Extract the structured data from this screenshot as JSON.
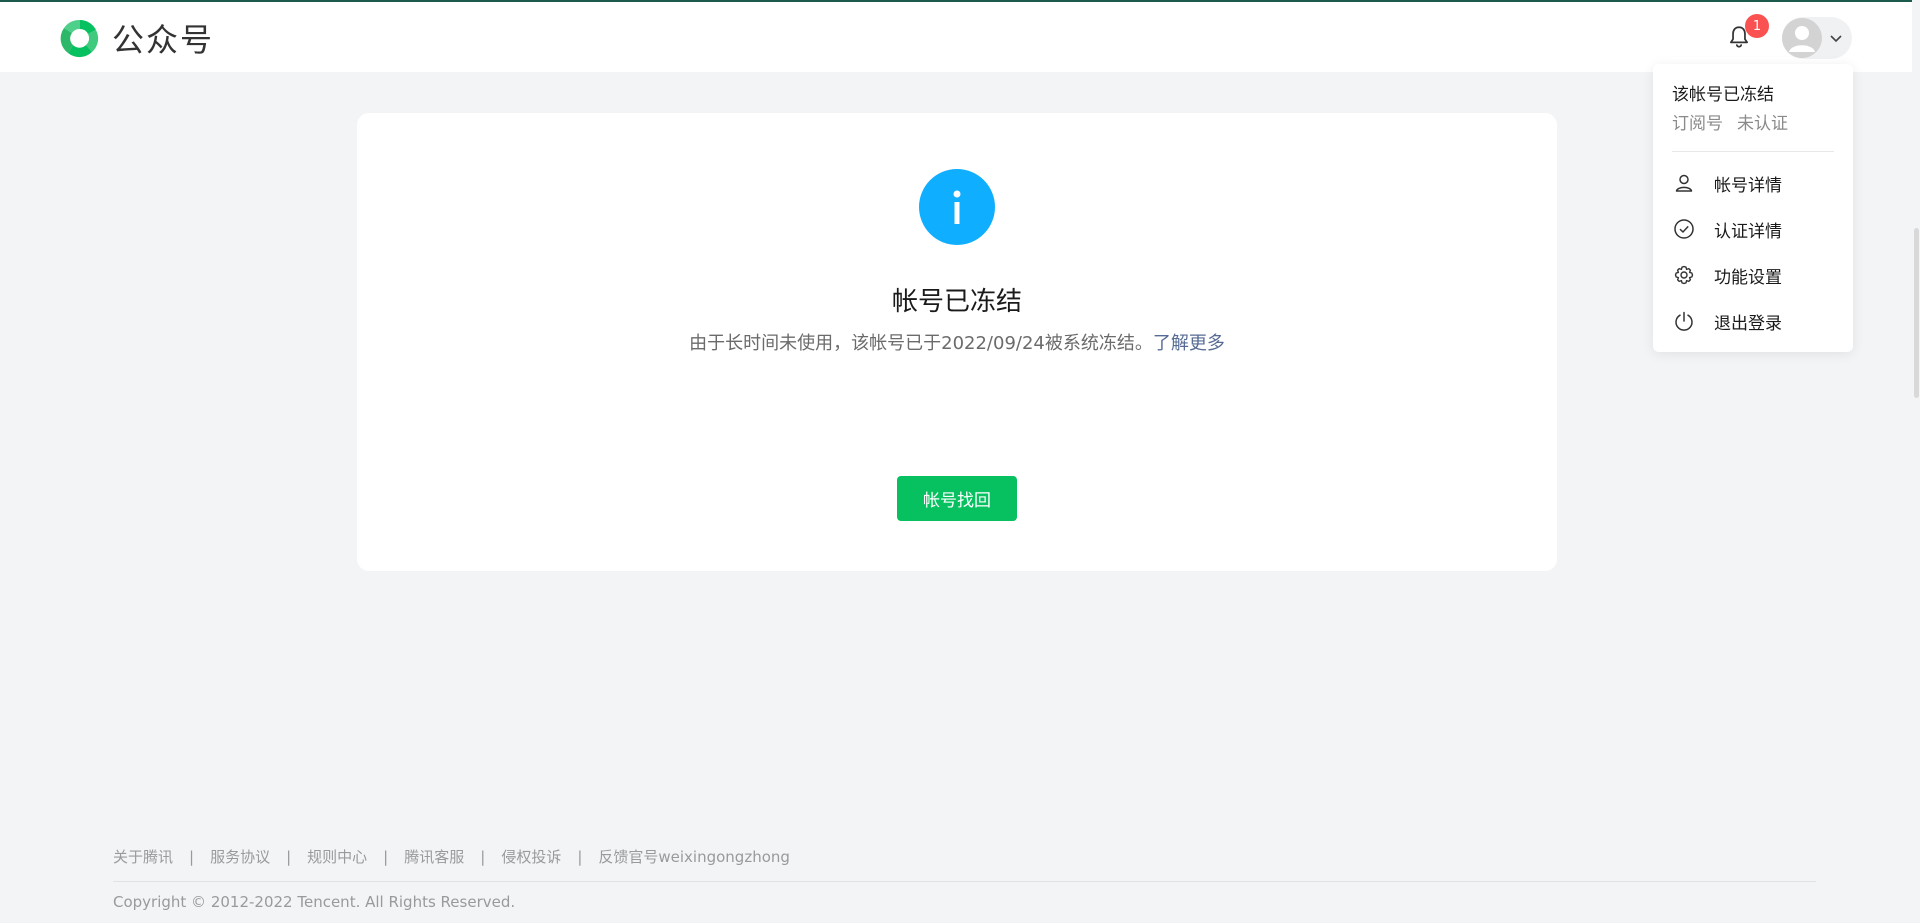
{
  "header": {
    "logo_text": "公众号",
    "notification_count": "1"
  },
  "card": {
    "title": "帐号已冻结",
    "description": "由于长时间未使用，该帐号已于2022/09/24被系统冻结。",
    "learn_more": "了解更多",
    "recover_button": "帐号找回"
  },
  "dropdown": {
    "account_name": "该帐号已冻结",
    "account_type": "订阅号",
    "verification_status": "未认证",
    "items": [
      {
        "label": "帐号详情",
        "icon": "user-icon"
      },
      {
        "label": "认证详情",
        "icon": "check-circle-icon"
      },
      {
        "label": "功能设置",
        "icon": "gear-icon"
      },
      {
        "label": "退出登录",
        "icon": "power-icon"
      }
    ]
  },
  "footer": {
    "links": [
      "关于腾讯",
      "服务协议",
      "规则中心",
      "腾讯客服",
      "侵权投诉",
      "反馈官号weixingongzhong"
    ],
    "separator": "|",
    "copyright": "Copyright © 2012-2022 Tencent. All Rights Reserved."
  },
  "colors": {
    "brand_green": "#07c160",
    "info_blue": "#10aeff",
    "badge_red": "#fa5151",
    "link_blue": "#576b95",
    "page_bg": "#f3f4f6"
  }
}
